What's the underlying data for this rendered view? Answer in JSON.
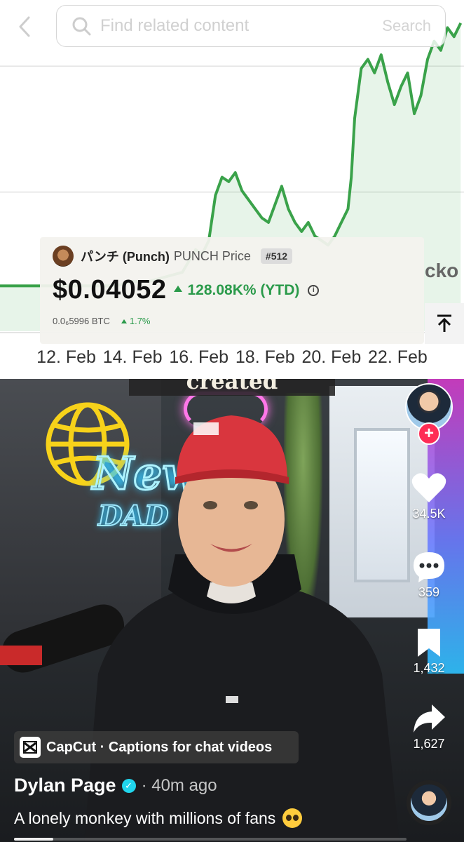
{
  "search": {
    "placeholder": "Find related content",
    "button_label": "Search"
  },
  "chart_data": {
    "type": "area",
    "color": "#3aa24a",
    "x_ticks": [
      "12. Feb",
      "14. Feb",
      "16. Feb",
      "18. Feb",
      "20. Feb",
      "22. Feb"
    ],
    "x_tick_positions": [
      11,
      13,
      15,
      17,
      19,
      21
    ],
    "grid": true,
    "series": [
      {
        "values": [
          [
            8.5,
            0.01
          ],
          [
            9.0,
            0.01
          ],
          [
            9.5,
            0.01
          ],
          [
            10.0,
            0.01
          ],
          [
            10.5,
            0.01
          ],
          [
            11.0,
            0.01
          ],
          [
            11.5,
            0.01
          ],
          [
            12.0,
            0.01
          ],
          [
            12.5,
            0.01
          ],
          [
            13.0,
            0.011
          ],
          [
            13.5,
            0.011
          ],
          [
            14.0,
            0.012
          ],
          [
            14.5,
            0.013
          ],
          [
            14.9,
            0.018
          ],
          [
            15.1,
            0.017
          ],
          [
            15.3,
            0.02
          ],
          [
            15.5,
            0.03
          ],
          [
            15.7,
            0.034
          ],
          [
            15.9,
            0.033
          ],
          [
            16.1,
            0.035
          ],
          [
            16.3,
            0.031
          ],
          [
            16.5,
            0.029
          ],
          [
            16.7,
            0.027
          ],
          [
            16.9,
            0.025
          ],
          [
            17.1,
            0.024
          ],
          [
            17.3,
            0.028
          ],
          [
            17.5,
            0.032
          ],
          [
            17.7,
            0.027
          ],
          [
            17.9,
            0.024
          ],
          [
            18.1,
            0.022
          ],
          [
            18.3,
            0.024
          ],
          [
            18.5,
            0.021
          ],
          [
            18.7,
            0.02
          ],
          [
            18.9,
            0.019
          ],
          [
            19.1,
            0.021
          ],
          [
            19.3,
            0.024
          ],
          [
            19.5,
            0.027
          ],
          [
            19.6,
            0.034
          ],
          [
            19.7,
            0.047
          ],
          [
            19.9,
            0.058
          ],
          [
            20.1,
            0.06
          ],
          [
            20.3,
            0.057
          ],
          [
            20.5,
            0.061
          ],
          [
            20.7,
            0.055
          ],
          [
            20.9,
            0.05
          ],
          [
            21.1,
            0.054
          ],
          [
            21.3,
            0.057
          ],
          [
            21.5,
            0.048
          ],
          [
            21.7,
            0.052
          ],
          [
            21.9,
            0.06
          ],
          [
            22.1,
            0.064
          ],
          [
            22.3,
            0.062
          ],
          [
            22.5,
            0.067
          ],
          [
            22.7,
            0.065
          ],
          [
            22.9,
            0.068
          ]
        ]
      }
    ]
  },
  "price_card": {
    "coin_name": "パンチ (Punch)",
    "coin_sub": "PUNCH Price",
    "rank": "#512",
    "price": "$0.04052",
    "change": "128.08K% (YTD)",
    "info_icon": "info-icon",
    "btc_price": "0.0₆5996 BTC",
    "btc_change": "1.7%"
  },
  "side_text": "cko",
  "caption": "created",
  "rail": {
    "likes": "34.5K",
    "comments": "359",
    "saves": "1,432",
    "shares": "1,627"
  },
  "capcut": {
    "label": "CapCut · Captions for chat videos"
  },
  "author": {
    "name": "Dylan Page",
    "time": "· 40m ago"
  },
  "description": "A lonely monkey with millions of fans",
  "progress": 0.1,
  "colors": {
    "accent": "#fe2c55",
    "chart_green": "#3aa24a",
    "gain_green": "#2a9a4a",
    "verified": "#20d5ec"
  }
}
